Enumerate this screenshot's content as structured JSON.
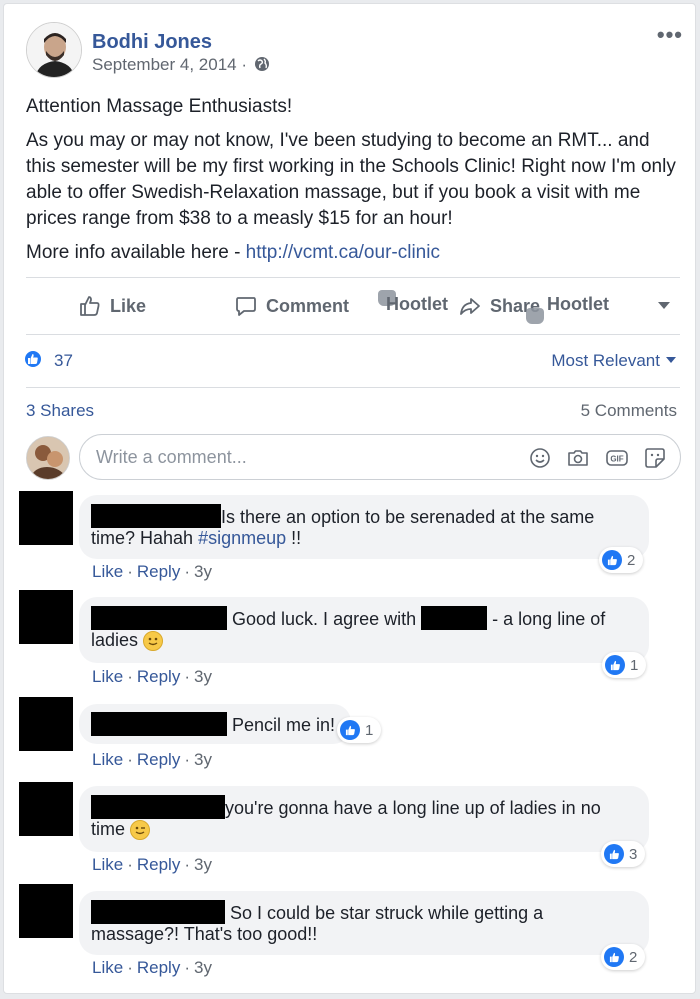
{
  "post": {
    "author": "Bodhi Jones",
    "date": "September 4, 2014 ·",
    "paragraphs": [
      "Attention Massage Enthusiasts!",
      "As you may or may not know, I've been studying to become an RMT... and this semester will be my first working in the Schools Clinic! Right now I'm only able to offer Swedish-Relaxation massage, but if you book a visit with me prices range from $38 to a measly $15 for an hour!"
    ],
    "more_info_prefix": "More info available here - ",
    "link": "http://vcmt.ca/our-clinic"
  },
  "actions": {
    "like": "Like",
    "comment": "Comment",
    "hootlet": "Hootlet",
    "share": "Share",
    "hootlet_share": "Hootlet"
  },
  "reactions": {
    "count": "37",
    "sort_label": "Most Relevant"
  },
  "stats": {
    "shares": "3 Shares",
    "comments": "5 Comments"
  },
  "comment_box": {
    "placeholder": "Write a comment..."
  },
  "comments": [
    {
      "line1": "Is there an option to be serenaded at the same",
      "line2_text": "time? Hahah ",
      "hashtag": "#signmeup",
      "line2_end": " !!",
      "likes": "2",
      "like": "Like",
      "reply": "Reply",
      "time": "3y"
    },
    {
      "line1_a": "Good luck. I agree with",
      "line1_b": "- a long line of",
      "line2": "ladies",
      "likes": "1",
      "like": "Like",
      "reply": "Reply",
      "time": "3y"
    },
    {
      "line1": "Pencil me in!",
      "likes": "1",
      "like": "Like",
      "reply": "Reply",
      "time": "3y"
    },
    {
      "line1": "you're gonna have a long line up of ladies in no",
      "line2": "time",
      "likes": "3",
      "like": "Like",
      "reply": "Reply",
      "time": "3y"
    },
    {
      "line1": "So I could be star struck while getting a",
      "line2": "massage?! That's too good!!",
      "likes": "2",
      "like": "Like",
      "reply": "Reply",
      "time": "3y"
    }
  ],
  "colors": {
    "link_blue": "#365899",
    "like_blue": "#2078f4",
    "muted": "#606770",
    "bubble": "#f2f3f5"
  }
}
